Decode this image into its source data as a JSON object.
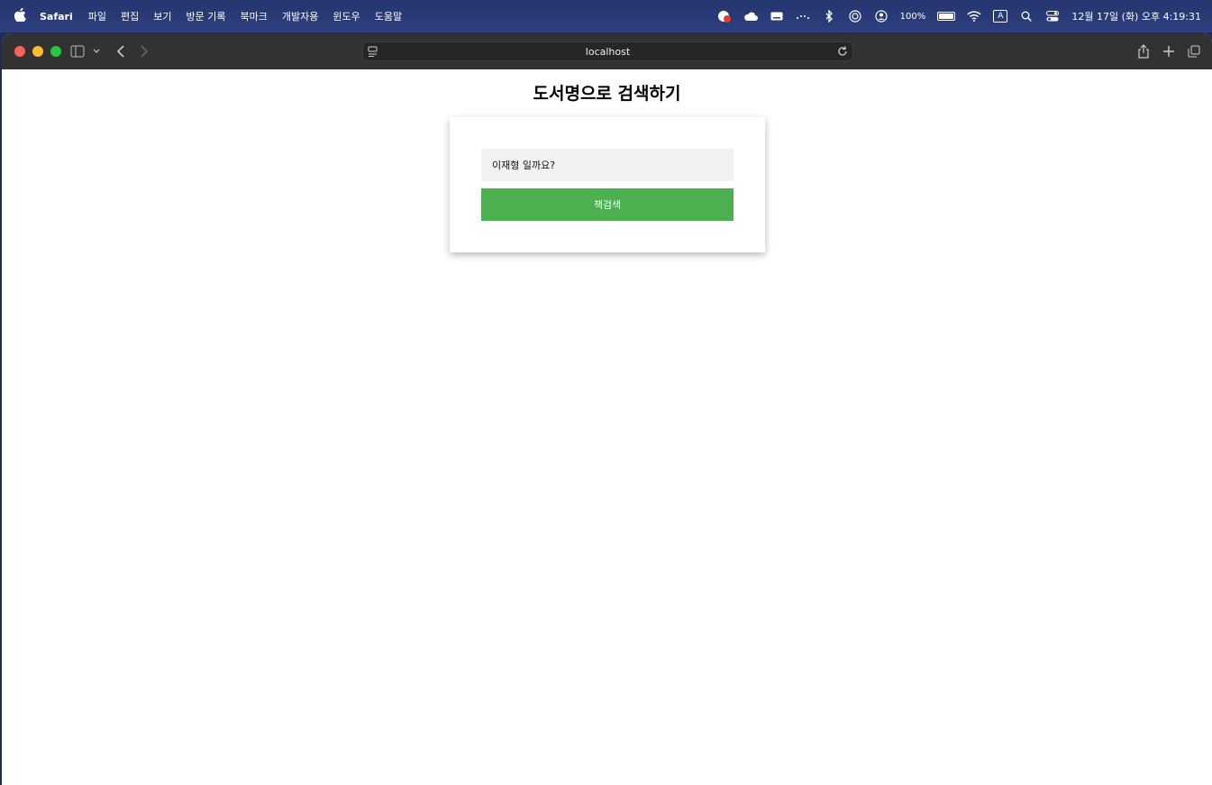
{
  "menubar": {
    "app_name": "Safari",
    "items": [
      "파일",
      "편집",
      "보기",
      "방문 기록",
      "북마크",
      "개발자용",
      "윈도우",
      "도움말"
    ],
    "battery": "100%",
    "input_mode": "A",
    "clock": "12월 17일 (화) 오후 4:19:31"
  },
  "browser": {
    "address": "localhost"
  },
  "page": {
    "title": "도서명으로 검색하기",
    "search_value": "이재형 일까요?",
    "search_button_label": "책검색"
  },
  "colors": {
    "button": "#4caf50",
    "menubar": "#2e3f7e",
    "toolbar": "#323232"
  }
}
